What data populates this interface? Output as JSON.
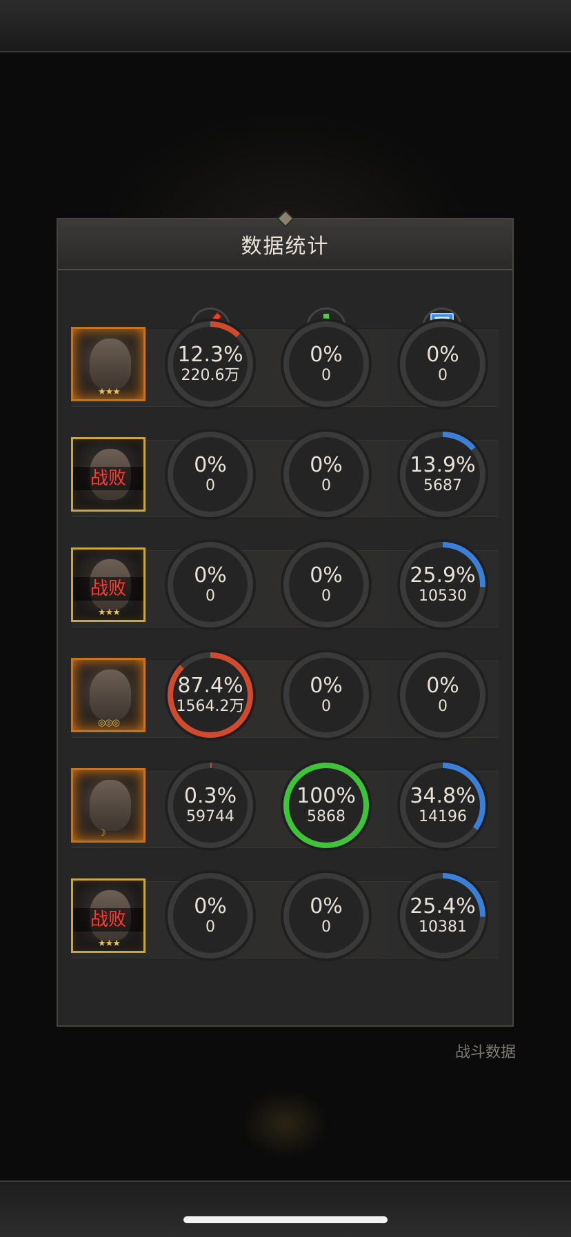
{
  "background": {
    "battle_data_label": "战斗数据"
  },
  "panel": {
    "title": "数据统计",
    "columns": [
      {
        "name": "damage",
        "icon": "red-sword-icon",
        "color": "#e8452c"
      },
      {
        "name": "healing",
        "icon": "green-heal-cross-icon",
        "color": "#4cd13c"
      },
      {
        "name": "damage-taken",
        "icon": "blue-shield-icon",
        "color": "#3d8be0"
      }
    ],
    "colors": {
      "damage": "#d04a2e",
      "healing": "#3fc33a",
      "tank": "#3b7fd6"
    },
    "rows": [
      {
        "defeated": false,
        "defeat_label": "",
        "rank_badge": "★★★",
        "damage": {
          "pct": "12.3%",
          "value": "220.6万",
          "frac": 0.123
        },
        "heal": {
          "pct": "0%",
          "value": "0",
          "frac": 0
        },
        "tank": {
          "pct": "0%",
          "value": "0",
          "frac": 0
        }
      },
      {
        "defeated": true,
        "defeat_label": "战败",
        "rank_badge": "",
        "damage": {
          "pct": "0%",
          "value": "0",
          "frac": 0
        },
        "heal": {
          "pct": "0%",
          "value": "0",
          "frac": 0
        },
        "tank": {
          "pct": "13.9%",
          "value": "5687",
          "frac": 0.139
        }
      },
      {
        "defeated": true,
        "defeat_label": "战败",
        "rank_badge": "★★★",
        "damage": {
          "pct": "0%",
          "value": "0",
          "frac": 0
        },
        "heal": {
          "pct": "0%",
          "value": "0",
          "frac": 0
        },
        "tank": {
          "pct": "25.9%",
          "value": "10530",
          "frac": 0.259
        }
      },
      {
        "defeated": false,
        "defeat_label": "",
        "rank_badge": "◎◎◎",
        "damage": {
          "pct": "87.4%",
          "value": "1564.2万",
          "frac": 0.874
        },
        "heal": {
          "pct": "0%",
          "value": "0",
          "frac": 0
        },
        "tank": {
          "pct": "0%",
          "value": "0",
          "frac": 0
        }
      },
      {
        "defeated": false,
        "defeat_label": "",
        "rank_badge": "☽",
        "damage": {
          "pct": "0.3%",
          "value": "59744",
          "frac": 0.003
        },
        "heal": {
          "pct": "100%",
          "value": "5868",
          "frac": 1.0
        },
        "tank": {
          "pct": "34.8%",
          "value": "14196",
          "frac": 0.348
        }
      },
      {
        "defeated": true,
        "defeat_label": "战败",
        "rank_badge": "★★★",
        "damage": {
          "pct": "0%",
          "value": "0",
          "frac": 0
        },
        "heal": {
          "pct": "0%",
          "value": "0",
          "frac": 0
        },
        "tank": {
          "pct": "25.4%",
          "value": "10381",
          "frac": 0.254
        }
      }
    ]
  }
}
